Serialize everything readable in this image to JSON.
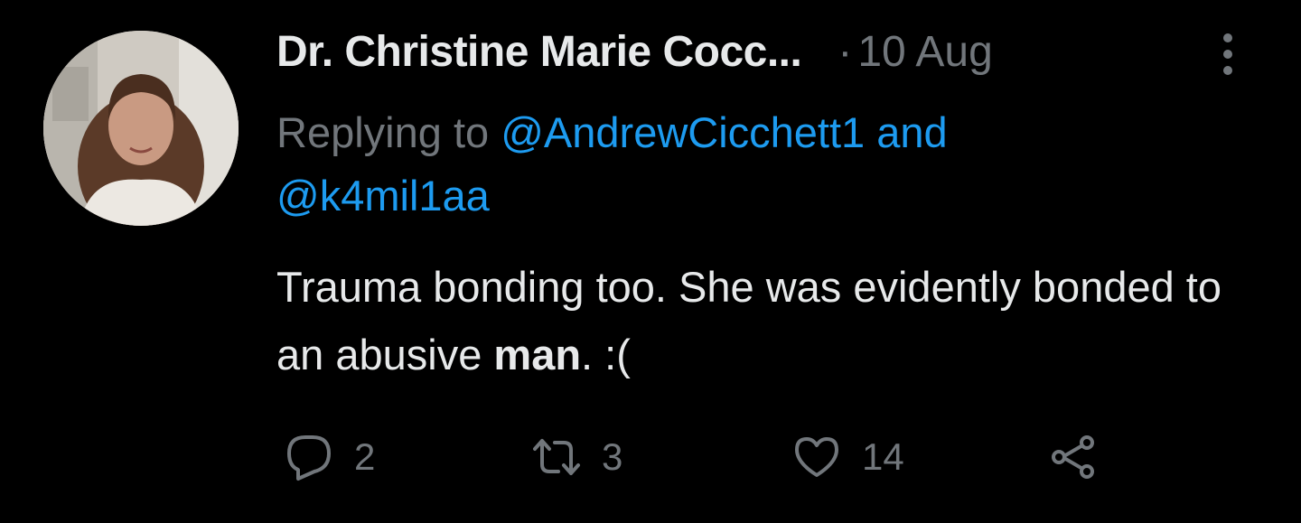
{
  "tweet": {
    "author_name": "Dr. Christine Marie Cocc...",
    "separator": "·",
    "date": "10 Aug",
    "replying_prefix": "Replying to ",
    "reply_mention_1": "@AndrewCicchett1",
    "reply_conjunction": " and",
    "reply_mention_2": "@k4mil1aa",
    "text_before_bold": "Trauma bonding too. She was evidently bonded to an abusive ",
    "text_bold": "man",
    "text_after_bold": ". :("
  },
  "actions": {
    "reply_count": "2",
    "retweet_count": "3",
    "like_count": "14"
  },
  "icons": {
    "more": "more-vertical-icon",
    "reply": "reply-bubble-icon",
    "retweet": "retweet-icon",
    "like": "heart-icon",
    "share": "share-icon"
  },
  "colors": {
    "background": "#000000",
    "text_primary": "#e7e9ea",
    "text_secondary": "#71767b",
    "accent": "#1d9bf0"
  }
}
